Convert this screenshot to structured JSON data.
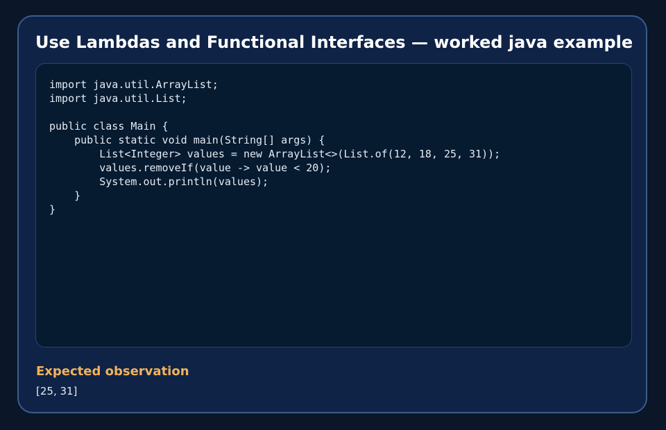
{
  "card": {
    "title": "Use Lambdas and Functional Interfaces — worked java example"
  },
  "code_block": {
    "language": "java",
    "source": "import java.util.ArrayList;\nimport java.util.List;\n\npublic class Main {\n    public static void main(String[] args) {\n        List<Integer> values = new ArrayList<>(List.of(12, 18, 25, 31));\n        values.removeIf(value -> value < 20);\n        System.out.println(values);\n    }\n}"
  },
  "observation": {
    "heading": "Expected observation",
    "value": "[25, 31]"
  },
  "colors": {
    "page_background": "#0b1628",
    "card_background": "#0f2347",
    "card_border": "#3a5d8c",
    "code_background": "#061a30",
    "heading_accent": "#f2b35a",
    "text": "#e6ebf2"
  }
}
